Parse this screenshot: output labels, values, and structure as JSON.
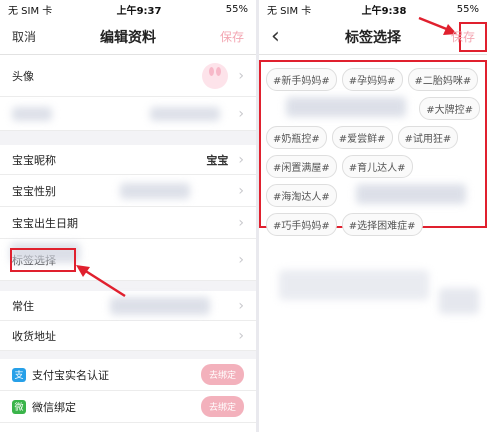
{
  "left": {
    "status": {
      "carrier": "无 SIM 卡",
      "time": "上午9:37",
      "battery": "55%"
    },
    "nav": {
      "cancel": "取消",
      "title": "编辑资料",
      "save": "保存"
    },
    "rows": {
      "avatar": "头像",
      "baby_nickname": "宝宝昵称",
      "baby_nickname_value": "宝宝",
      "baby_gender": "宝宝性别",
      "baby_birthday": "宝宝出生日期",
      "tag_select": "标签选择",
      "residence": "常住",
      "shipping_address": "收货地址"
    },
    "bindings": [
      {
        "label": "支付宝实名认证",
        "icon": "alipay-icon",
        "button": "去绑定"
      },
      {
        "label": "微信绑定",
        "icon": "wechat-icon",
        "button": "去绑定"
      }
    ]
  },
  "right": {
    "status": {
      "carrier": "无 SIM 卡",
      "time": "上午9:38",
      "battery": "55%"
    },
    "nav": {
      "back": "‹",
      "title": "标签选择",
      "save": "保存"
    },
    "tags": [
      [
        "#新手妈妈#",
        "#孕妈妈#",
        "#二胎妈咪#"
      ],
      [
        "#大牌控#"
      ],
      [
        "#奶瓶控#",
        "#爱尝鲜#",
        "#试用狂#"
      ],
      [
        "#闲置满屋#",
        "#育儿达人#"
      ],
      [
        "#海淘达人#"
      ],
      [
        "#巧手妈妈#",
        "#选择困难症#"
      ]
    ]
  },
  "colors": {
    "accent_pink": "#f3a6b2",
    "highlight_red": "#e0202e"
  }
}
